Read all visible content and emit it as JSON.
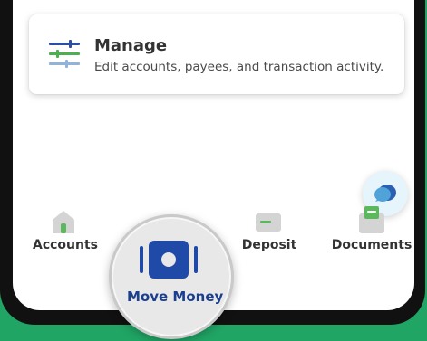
{
  "manage_card": {
    "title": "Manage",
    "subtitle": "Edit accounts, payees, and transaction activity.",
    "icon": "sliders-icon"
  },
  "chat": {
    "icon": "chat-bubble-icon"
  },
  "bottom_nav": {
    "items": [
      {
        "label": "Accounts",
        "icon": "house-icon"
      },
      {
        "label": "Move Money",
        "icon": "move-money-icon",
        "highlighted": true
      },
      {
        "label": "Deposit",
        "icon": "check-deposit-icon"
      },
      {
        "label": "Documents",
        "icon": "documents-icon"
      }
    ]
  },
  "colors": {
    "brand_green": "#20a565",
    "nav_blue": "#1f4aa8",
    "icon_green": "#5cb85c",
    "icon_gray": "#d4d4d4"
  }
}
